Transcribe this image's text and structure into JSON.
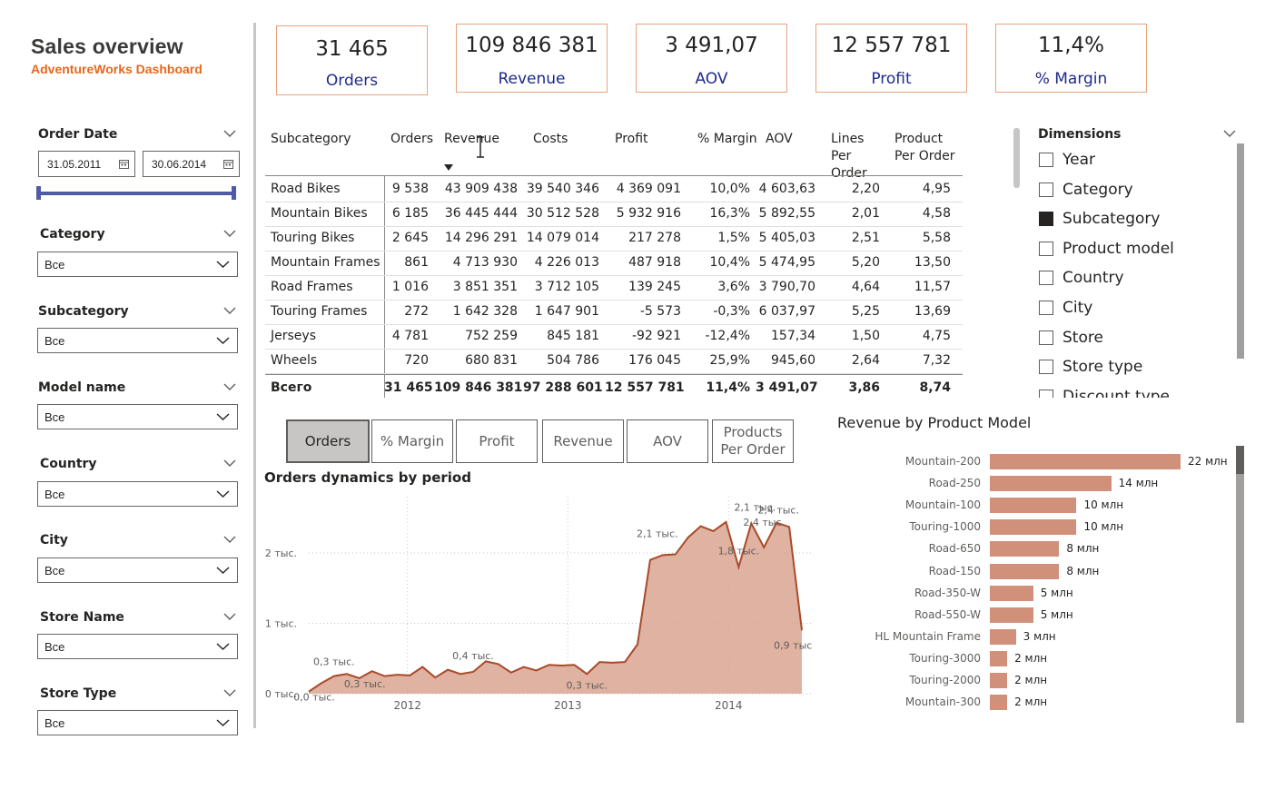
{
  "header": {
    "title": "Sales overview",
    "subtitle": "AdventureWorks Dashboard"
  },
  "filters": {
    "order_date": {
      "label": "Order Date",
      "start": "31.05.2011",
      "end": "30.06.2014"
    },
    "category": {
      "label": "Category",
      "value": "Все"
    },
    "subcategory": {
      "label": "Subcategory",
      "value": "Все"
    },
    "model_name": {
      "label": "Model name",
      "value": "Все"
    },
    "country": {
      "label": "Country",
      "value": "Все"
    },
    "city": {
      "label": "City",
      "value": "Все"
    },
    "store_name": {
      "label": "Store Name",
      "value": "Все"
    },
    "store_type": {
      "label": "Store Type",
      "value": "Все"
    }
  },
  "kpis": [
    {
      "value": "31 465",
      "label": "Orders"
    },
    {
      "value": "109 846 381",
      "label": "Revenue"
    },
    {
      "value": "3 491,07",
      "label": "AOV"
    },
    {
      "value": "12 557 781",
      "label": "Profit"
    },
    {
      "value": "11,4%",
      "label": "% Margin"
    }
  ],
  "table": {
    "headers": [
      "Subcategory",
      "Orders",
      "Revenue",
      "Costs",
      "Profit",
      "% Margin",
      "AOV",
      "Lines Per Order",
      "Product Per Order"
    ],
    "rows": [
      [
        "Road Bikes",
        "9 538",
        "43 909 438",
        "39 540 346",
        "4 369 091",
        "10,0%",
        "4 603,63",
        "2,20",
        "4,95"
      ],
      [
        "Mountain Bikes",
        "6 185",
        "36 445 444",
        "30 512 528",
        "5 932 916",
        "16,3%",
        "5 892,55",
        "2,01",
        "4,58"
      ],
      [
        "Touring Bikes",
        "2 645",
        "14 296 291",
        "14 079 014",
        "217 278",
        "1,5%",
        "5 405,03",
        "2,51",
        "5,58"
      ],
      [
        "Mountain Frames",
        "861",
        "4 713 930",
        "4 226 013",
        "487 918",
        "10,4%",
        "5 474,95",
        "5,20",
        "13,50"
      ],
      [
        "Road Frames",
        "1 016",
        "3 851 351",
        "3 712 105",
        "139 245",
        "3,6%",
        "3 790,70",
        "4,64",
        "11,57"
      ],
      [
        "Touring Frames",
        "272",
        "1 642 328",
        "1 647 901",
        "-5 573",
        "-0,3%",
        "6 037,97",
        "5,25",
        "13,69"
      ],
      [
        "Jerseys",
        "4 781",
        "752 259",
        "845 181",
        "-92 921",
        "-12,4%",
        "157,34",
        "1,50",
        "4,75"
      ],
      [
        "Wheels",
        "720",
        "680 831",
        "504 786",
        "176 045",
        "25,9%",
        "945,60",
        "2,64",
        "7,32"
      ]
    ],
    "total": [
      "Всего",
      "31 465",
      "109 846 381",
      "97 288 601",
      "12 557 781",
      "11,4%",
      "3 491,07",
      "3,86",
      "8,74"
    ]
  },
  "dimensions": {
    "label": "Dimensions",
    "items": [
      {
        "label": "Year",
        "checked": false
      },
      {
        "label": "Category",
        "checked": false
      },
      {
        "label": "Subcategory",
        "checked": true
      },
      {
        "label": "Product model",
        "checked": false
      },
      {
        "label": "Country",
        "checked": false
      },
      {
        "label": "City",
        "checked": false
      },
      {
        "label": "Store",
        "checked": false
      },
      {
        "label": "Store type",
        "checked": false
      },
      {
        "label": "Discount type",
        "checked": false
      }
    ]
  },
  "metric_buttons": [
    "Orders",
    "% Margin",
    "Profit",
    "Revenue",
    "AOV",
    "Products Per Order"
  ],
  "colors": {
    "accent": "#e8671c",
    "kpi_label": "#1e2a8a",
    "area": "#d9a591",
    "line": "#a94a2a",
    "bar": "#d0907a"
  },
  "chart_data": [
    {
      "type": "area",
      "title": "Orders dynamics by period",
      "y_ticks": [
        "0 тыс.",
        "1 тыс.",
        "2 тыс."
      ],
      "x_ticks": [
        "2012",
        "2013",
        "2014"
      ],
      "ylim": [
        0,
        2800
      ],
      "x": [
        "2011-05",
        "2011-06",
        "2011-07",
        "2011-08",
        "2011-09",
        "2011-10",
        "2011-11",
        "2011-12",
        "2012-01",
        "2012-02",
        "2012-03",
        "2012-04",
        "2012-05",
        "2012-06",
        "2012-07",
        "2012-08",
        "2012-09",
        "2012-10",
        "2012-11",
        "2012-12",
        "2013-01",
        "2013-02",
        "2013-03",
        "2013-04",
        "2013-05",
        "2013-06",
        "2013-07",
        "2013-08",
        "2013-09",
        "2013-10",
        "2013-11",
        "2013-12",
        "2014-01",
        "2014-02",
        "2014-03",
        "2014-04",
        "2014-05",
        "2014-06"
      ],
      "values": [
        30,
        150,
        250,
        280,
        220,
        320,
        250,
        270,
        260,
        380,
        230,
        340,
        280,
        310,
        460,
        420,
        300,
        380,
        330,
        410,
        400,
        410,
        280,
        450,
        440,
        450,
        700,
        1900,
        1970,
        1980,
        2220,
        2380,
        2310,
        2440,
        1800,
        2420,
        2080,
        2430,
        2370,
        900
      ],
      "data_labels": [
        "0,0 тыс.",
        "0,3 тыс.",
        "0,3 тыс.",
        "0,4 тыс.",
        "0,3 тыс.",
        "2,1 тыс.",
        "1,8 тыс.",
        "2,1 тыс.",
        "2,4 тыс.",
        "2,4 тыс.",
        "0,9 тыс."
      ]
    },
    {
      "type": "bar",
      "title": "Revenue by Product Model",
      "categories": [
        "Mountain-200",
        "Road-250",
        "Mountain-100",
        "Touring-1000",
        "Road-650",
        "Road-150",
        "Road-350-W",
        "Road-550-W",
        "HL Mountain Frame",
        "Touring-3000",
        "Touring-2000",
        "Mountain-300"
      ],
      "values": [
        22,
        14,
        10,
        10,
        8,
        8,
        5,
        5,
        3,
        2,
        2,
        2
      ],
      "value_labels": [
        "22 млн",
        "14 млн",
        "10 млн",
        "10 млн",
        "8 млн",
        "8 млн",
        "5 млн",
        "5 млн",
        "3 млн",
        "2 млн",
        "2 млн",
        "2 млн"
      ]
    }
  ]
}
